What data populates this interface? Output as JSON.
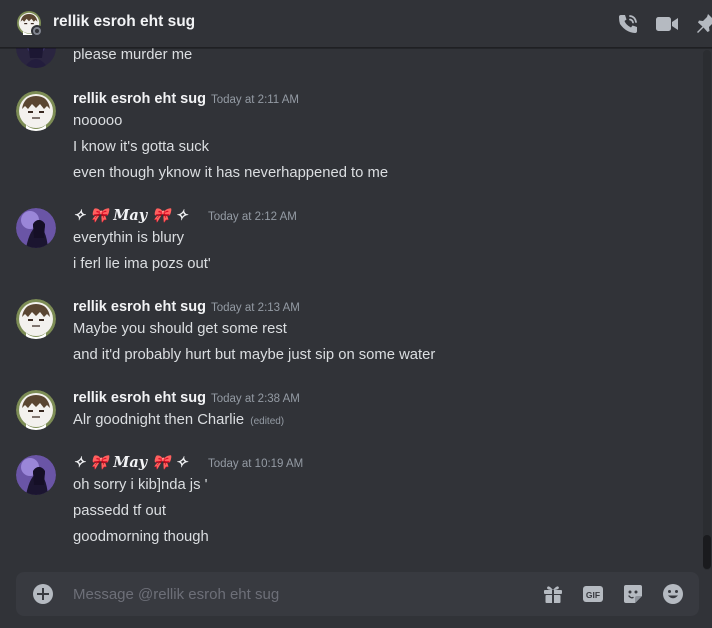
{
  "header": {
    "title": "rellik esroh eht sug",
    "icons": [
      "phone-call-icon",
      "video-camera-icon",
      "pin-icon"
    ]
  },
  "messages": {
    "partial_first": {
      "text": "please murder me"
    },
    "groups": [
      {
        "author": "rellik esroh eht sug",
        "timestamp": "Today at 2:11 AM",
        "lines": [
          "nooooo",
          "I know it's gotta suck",
          "even though yknow it has neverhappened to me"
        ]
      },
      {
        "author": "✧ 🎀 𝑴𝒂𝒚 🎀 ✧",
        "timestamp": "Today at 2:12 AM",
        "lines": [
          "everythin is blury",
          "i ferl lie ima pozs out'"
        ]
      },
      {
        "author": "rellik esroh eht sug",
        "timestamp": "Today at 2:13 AM",
        "lines": [
          "Maybe you should get some rest",
          "and it'd probably hurt but maybe just sip on some water"
        ]
      },
      {
        "author": "rellik esroh eht sug",
        "timestamp": "Today at 2:38 AM",
        "lines": [
          "Alr goodnight then Charlie"
        ],
        "edited": "(edited)"
      },
      {
        "author": "✧ 🎀 𝑴𝒂𝒚 🎀 ✧",
        "timestamp": "Today at 10:19 AM",
        "lines": [
          "oh sorry i kib]nda js '",
          "passedd tf  out",
          "goodmorning though"
        ]
      }
    ]
  },
  "composer": {
    "placeholder": "Message @rellik esroh eht sug",
    "value": "",
    "icons": [
      "add-attachment-icon",
      "gift-icon",
      "gif-icon",
      "sticker-icon",
      "emoji-icon"
    ]
  },
  "colors": {
    "background": "#313338",
    "composer": "#383a40",
    "text": "#dbdee1",
    "muted": "#949ba4",
    "bow_red": "#dd2e44"
  }
}
